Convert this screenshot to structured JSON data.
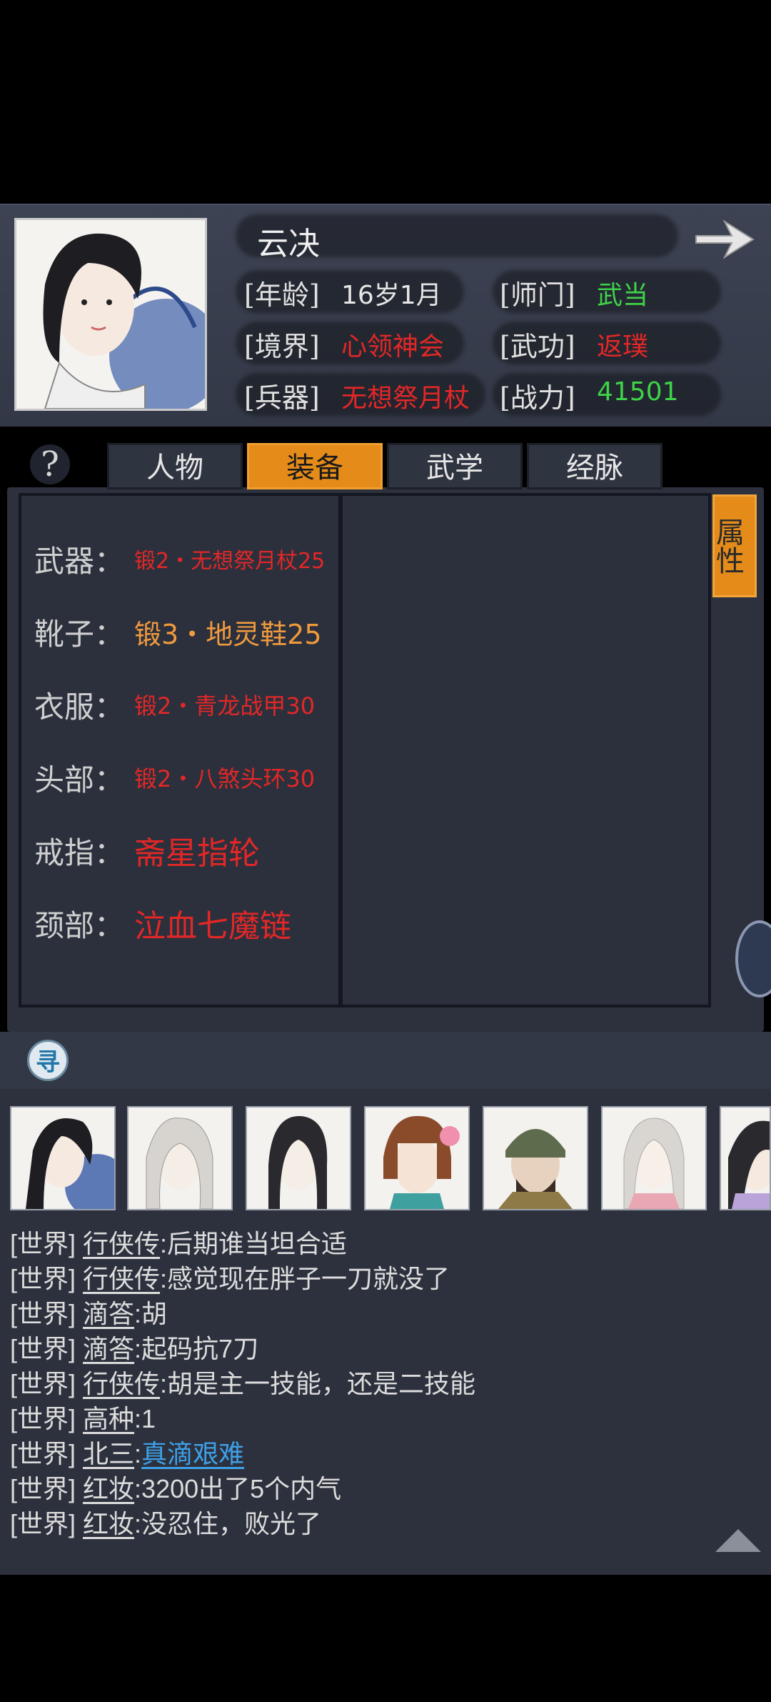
{
  "character": {
    "name": "云决",
    "age_label": "[年龄]",
    "age": "16岁1月",
    "sect_label": "[师门]",
    "sect": "武当",
    "realm_label": "[境界]",
    "realm": "心领神会",
    "skill_label": "[武功]",
    "skill": "返璞",
    "weapon_label": "[兵器]",
    "weapon": "无想祭月杖",
    "power_label": "[战力]",
    "power": "41501"
  },
  "help_icon": "?",
  "tabs": [
    "人物",
    "装备",
    "武学",
    "经脉"
  ],
  "active_tab": "装备",
  "attr_button": "属性",
  "equipment": [
    {
      "slot": "武器：",
      "item": "锻2・无想祭月杖25",
      "color": "#e32727",
      "size": 30
    },
    {
      "slot": "靴子：",
      "item": "锻3・地灵鞋25",
      "color": "#f09a3e",
      "size": 38
    },
    {
      "slot": "衣服：",
      "item": "锻2・青龙战甲30",
      "color": "#e32727",
      "size": 32
    },
    {
      "slot": "头部：",
      "item": "锻2・八煞头环30",
      "color": "#e32727",
      "size": 32
    },
    {
      "slot": "戒指：",
      "item": "斋星指轮",
      "color": "#e32727",
      "size": 44
    },
    {
      "slot": "颈部：",
      "item": "泣血七魔链",
      "color": "#e32727",
      "size": 44
    }
  ],
  "chat_toggle_icon": "寻",
  "chat": [
    {
      "channel": "[世界]",
      "name": "行侠传",
      "msg": ":后期谁当坦合适"
    },
    {
      "channel": "[世界]",
      "name": "行侠传",
      "msg": ":感觉现在胖子一刀就没了"
    },
    {
      "channel": "[世界]",
      "name": "滴答",
      "msg": ":胡"
    },
    {
      "channel": "[世界]",
      "name": "滴答",
      "msg": ":起码抗7刀"
    },
    {
      "channel": "[世界]",
      "name": "行侠传",
      "msg": ":胡是主一技能，还是二技能"
    },
    {
      "channel": "[世界]",
      "name": "高种",
      "msg": ":1"
    },
    {
      "channel": "[世界]",
      "name": "北三",
      "msg": ":",
      "link": "真滴艰难"
    },
    {
      "channel": "[世界]",
      "name": "红妆",
      "msg": ":3200出了5个内气"
    },
    {
      "channel": "[世界]",
      "name": "红妆",
      "msg": ":没忍住，败光了"
    }
  ],
  "colors": {
    "accent": "#e48b1a",
    "green": "#3fd24a",
    "red": "#e32727",
    "link": "#3ea0e8"
  }
}
